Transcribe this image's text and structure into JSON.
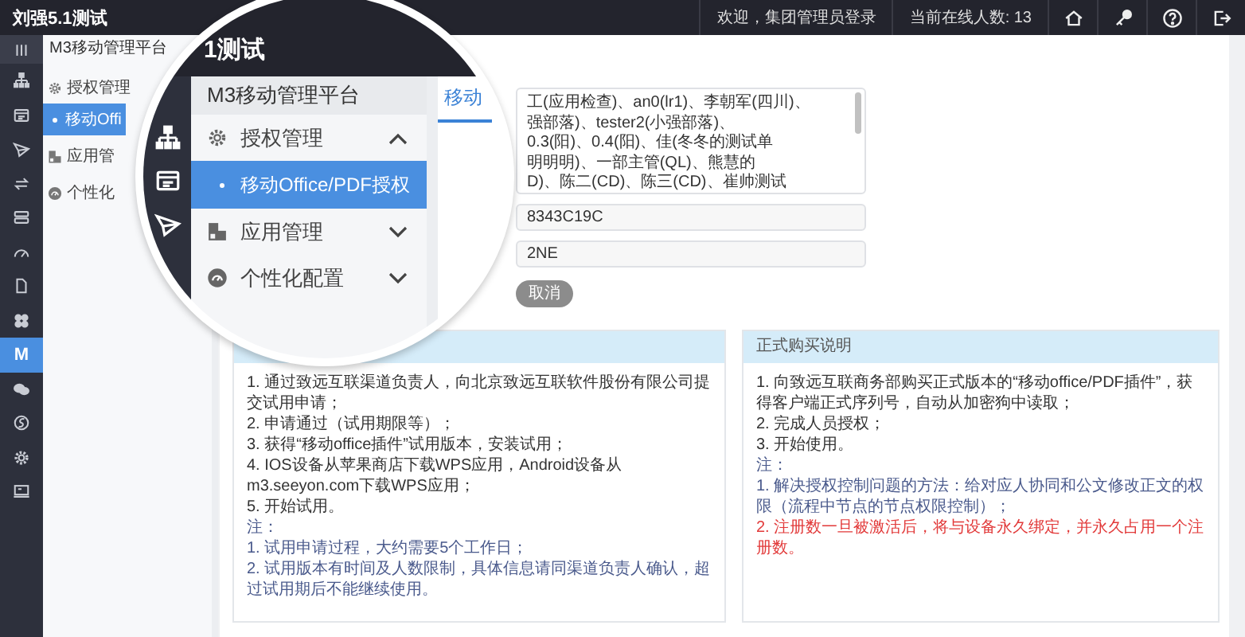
{
  "header": {
    "title": "刘强5.1测试",
    "welcome": "欢迎，集团管理员登录",
    "online": "当前在线人数: 13"
  },
  "rail": [
    {
      "selected": false
    },
    {
      "selected": false
    },
    {
      "selected": false
    },
    {
      "selected": false
    },
    {
      "selected": false
    },
    {
      "selected": false
    },
    {
      "selected": false
    },
    {
      "selected": false
    },
    {
      "selected": false
    },
    {
      "label": "M",
      "selected": true
    },
    {
      "selected": false
    },
    {
      "selected": false
    },
    {
      "selected": false
    },
    {
      "selected": false
    }
  ],
  "sidebar": {
    "title": "M3移动管理平台",
    "items": [
      {
        "label": "授权管理",
        "selected": false,
        "children": [
          {
            "label": "移动Offi",
            "selected": true
          }
        ]
      },
      {
        "label": "应用管",
        "selected": false
      },
      {
        "label": "个性化",
        "selected": false
      }
    ]
  },
  "form": {
    "recipients": [
      "工(应用检查)、an0(lr1)、李朝军(四川)、",
      "强部落)、tester2(小强部落)、",
      "0.3(阳)、0.4(阳)、佳(冬冬的测试单",
      "明明明)、一部主管(QL)、熊慧的",
      "D)、陈二(CD)、陈三(CD)、崔帅测试"
    ],
    "fields": [
      {
        "value": "8343C19C"
      },
      {
        "value": "2NE"
      }
    ],
    "cancel": "取消"
  },
  "panels": [
    {
      "lines": [
        {
          "text": "1. 通过致远互联渠道负责人，向北京致远互联软件股份有限公司提交试用申请；",
          "kind": "normal"
        },
        {
          "text": "2. 申请通过（试用期限等）；",
          "kind": "normal"
        },
        {
          "text": "3. 获得“移动office插件”试用版本，安装试用；",
          "kind": "normal"
        },
        {
          "text": "4. IOS设备从苹果商店下载WPS应用，Android设备从m3.seeyon.com下载WPS应用；",
          "kind": "normal"
        },
        {
          "text": "5. 开始试用。",
          "kind": "normal"
        },
        {
          "text": "注：",
          "kind": "note"
        },
        {
          "text": "1. 试用申请过程，大约需要5个工作日；",
          "kind": "note"
        },
        {
          "text": "2. 试用版本有时间及人数限制，具体信息请同渠道负责人确认，超过试用期后不能继续使用。",
          "kind": "note"
        }
      ]
    },
    {
      "title": "正式购买说明",
      "lines": [
        {
          "text": "1. 向致远互联商务部购买正式版本的“移动office/PDF插件”，获得客户端正式序列号，自动从加密狗中读取；",
          "kind": "normal"
        },
        {
          "text": "2. 完成人员授权；",
          "kind": "normal"
        },
        {
          "text": "3. 开始使用。",
          "kind": "normal"
        },
        {
          "text": "注：",
          "kind": "note"
        },
        {
          "text": "1. 解决授权控制问题的方法：给对应人协同和公文修改正文的权限（流程中节点的节点权限控制）；",
          "kind": "note"
        },
        {
          "text": "2. 注册数一旦被激活后，将与设备永久绑定，并永久占用一个注册数。",
          "kind": "warn"
        }
      ]
    }
  ],
  "lens": {
    "title": "1测试",
    "sidebar_title": "M3移动管理平台",
    "items": [
      {
        "label": "授权管理",
        "selected": false,
        "expanded": true,
        "children": [
          {
            "label": "移动Office/PDF授权",
            "selected": true
          }
        ]
      },
      {
        "label": "应用管理",
        "selected": false,
        "expanded": false
      },
      {
        "label": "个性化配置",
        "selected": false,
        "expanded": false
      }
    ],
    "tab": {
      "label": "移动",
      "selected": true
    }
  }
}
